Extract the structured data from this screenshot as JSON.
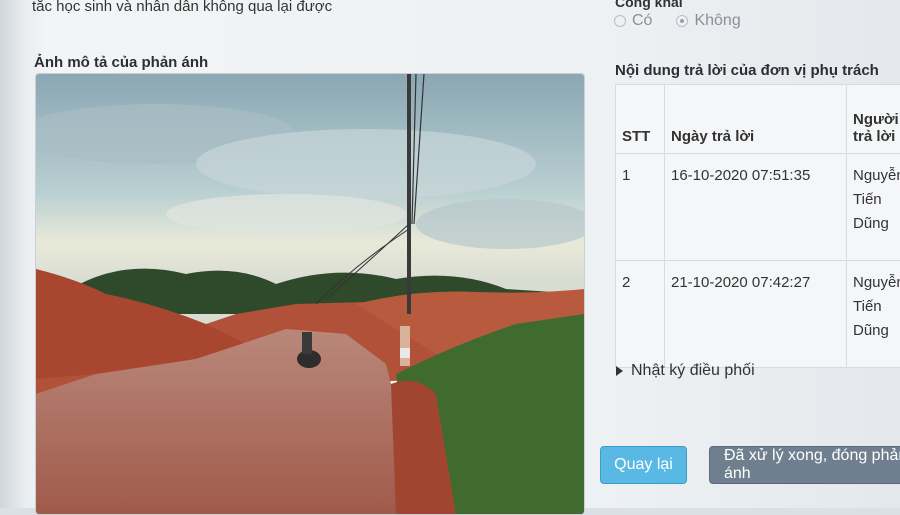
{
  "description_tail": "tắc học sinh và nhân dân không qua lại được",
  "photo": {
    "label": "Ảnh mô tả của phản ánh"
  },
  "public": {
    "heading": "Công khai",
    "options": [
      "Có",
      "Không"
    ],
    "selected": "Không"
  },
  "reply": {
    "title": "Nội dung trả lời của đơn vị phụ trách",
    "columns": [
      "STT",
      "Ngày trả lời",
      "Người trả lời"
    ],
    "rows": [
      {
        "stt": "1",
        "date": "16-10-2020 07:51:35",
        "responder": "Nguyễn Tiến Dũng"
      },
      {
        "stt": "2",
        "date": "21-10-2020 07:42:27",
        "responder": "Nguyễn Tiến Dũng"
      }
    ]
  },
  "log_toggle": "Nhật ký điều phối",
  "buttons": {
    "back": "Quay lại",
    "done": "Đã xử lý xong, đóng phản ánh"
  }
}
